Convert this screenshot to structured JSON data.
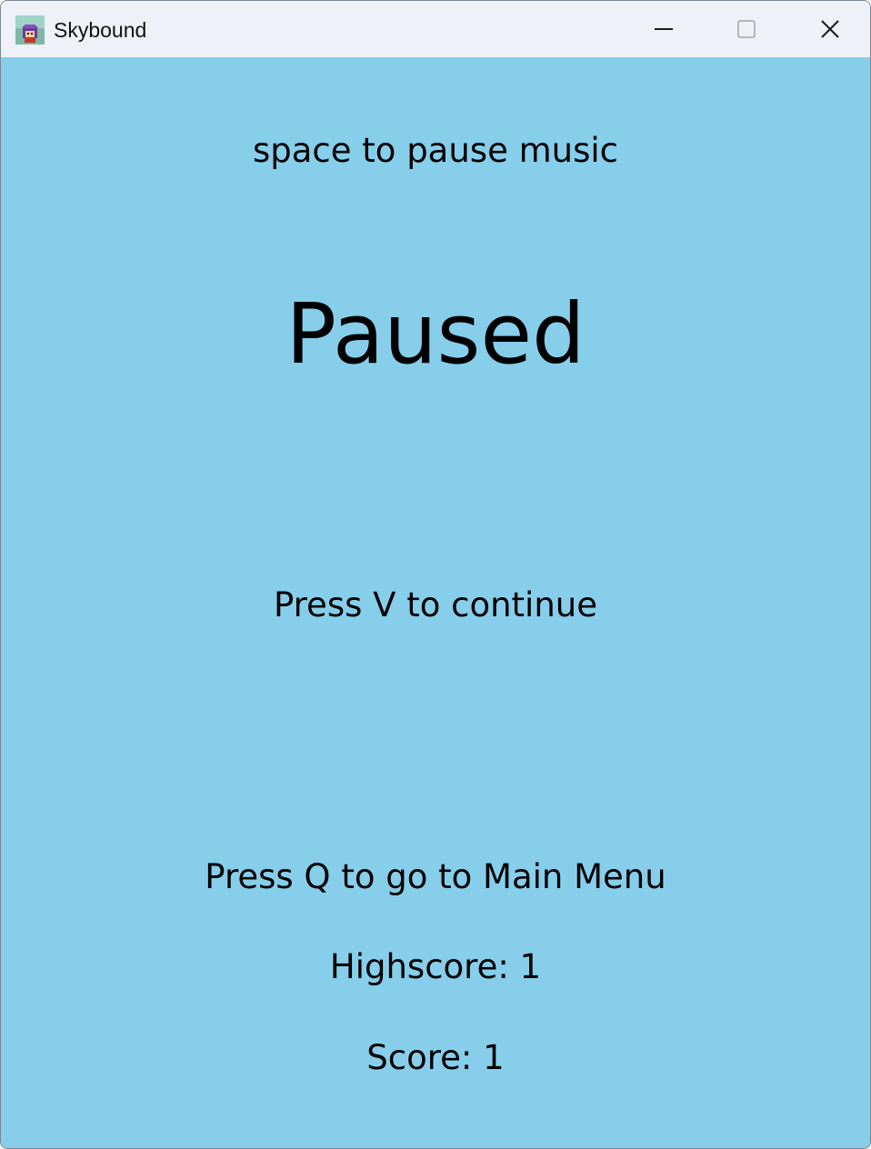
{
  "window": {
    "title": "Skybound",
    "app_icon": "skybound-character-icon",
    "controls": [
      "minimize-icon",
      "maximize-icon",
      "close-icon"
    ],
    "background_color": "#87ceeb"
  },
  "pause_screen": {
    "music_hint": "space to pause music",
    "title": "Paused",
    "continue_hint": "Press V to continue",
    "menu_hint": "Press Q to go to Main Menu",
    "highscore": "Highscore: 1",
    "score": "Score: 1"
  }
}
